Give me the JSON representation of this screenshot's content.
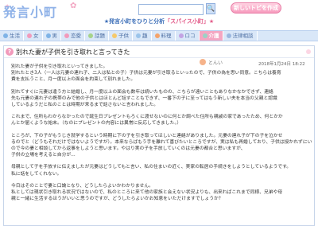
{
  "header": {
    "logo_text": "発言小町",
    "search_placeholder": "",
    "search_button": "🔍",
    "new_topic_button": "新しいトピを作成",
    "tagline_prefix": "★発言小町をひりと分析",
    "tagline_highlight": "「スパイス小町」★"
  },
  "nav": {
    "items": [
      {
        "label": "生活",
        "color": "#7fb3e6",
        "active": false
      },
      {
        "label": "女",
        "color": "#f29abb",
        "active": false
      },
      {
        "label": "男",
        "color": "#7fb3e6",
        "active": false
      },
      {
        "label": "恋愛",
        "color": "#f29abb",
        "active": false
      },
      {
        "label": "話題",
        "color": "#a6d38a",
        "active": false
      },
      {
        "label": "子供",
        "color": "#f6c96b",
        "active": false
      },
      {
        "label": "趣",
        "color": "#9bc4ea",
        "active": false
      },
      {
        "label": "料理",
        "color": "#f4a36b",
        "active": false
      },
      {
        "label": "ロコ",
        "color": "#c2a3e3",
        "active": false
      },
      {
        "label": "介護",
        "color": "#9bd2c5",
        "active": true
      },
      {
        "label": "法律相談",
        "color": "#9bb7df",
        "active": false
      }
    ]
  },
  "post": {
    "title": "別れた妻が子供を引き取れと言ってきた",
    "author": "とんい",
    "date": "2018年1月24日 18:22",
    "paragraphs": [
      [
        "別れた妻が子供を引き取れといってきました。",
        "別れたとき3人（一人は元妻の連れ子、二人は私との子）子供は元妻が引き取るといったので、子供の為を思い同意。こちらは養育",
        "費を支払うこと、月一度以上の面会を約束して別れました。"
      ],
      [
        "別れてすぐに元妻は違う方と結婚し、月一度以上の面会も数年は続いたものの、こちらが遠いこともありなかなかできず、連絡",
        "先も元妻の連れ子の携帯のみで他の子供とはほとんど話すこともできず、一番下の子に至ってはもう新しい夫を本当の父親と認識",
        "しているようだと私のことは時期が来るまで話さないと言われました。"
      ],
      [
        "これまで、住所もわからなかったので誕生日プレゼントもろくに渡せないのに何とか調べた住所も親戚の家であったため、何とかか",
        "んとか届くような始末。（なのにプレゼントの内容には異常に反応してきました。）"
      ],
      [
        "ところが、下の子がもうじき就学するという時期に下の子を引き取ってほしいと連絡がありました。元妻の連れ子が下の子を泣かせ",
        "るのでと（どうもそれだけではないようですが）。本来ならばもう手を離れて喜びたいところですが、実は私も再婚しており、子供は授かれずにいる",
        "ので今の妻と相談してから返事をしようと思います。やはり実の子を手放していくのは元妻の都合と思いますが、",
        "子供の立場を考えると自分が..."
      ],
      [
        "母親として子を手放すに伝えましたが元妻はどうしてもと言い、私の住まいの近く、実家の転居の手続きをしようとしているようです。",
        "私に話をしてくれない。"
      ],
      [
        "今日はそのことで妻と口論となり、どうしたらよいかわかりません。",
        "私としては現状引き取れる状況ではないので、私のところに来て他の家族と会えない状況よりも、出来ればこれまで同様、兄弟や母",
        "親と一緒に生活するほうがいいと思うのですが、どうしたらよいかお知恵をいただけますでしょうか？"
      ]
    ]
  }
}
